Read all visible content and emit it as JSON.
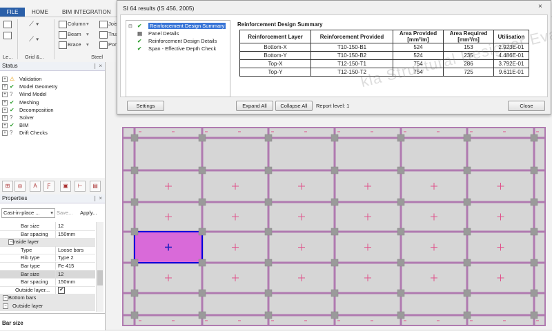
{
  "ribbon": {
    "file_tab": "FILE",
    "tabs": [
      "HOME",
      "BIM INTEGRATION"
    ],
    "tools": {
      "column": "Column",
      "joist": "Joist",
      "beam": "Beam",
      "truss": "Truss",
      "brace": "Brace",
      "port": "Port"
    },
    "groups": {
      "levels": "Le...",
      "grid": "Grid &...",
      "steel": "Steel"
    }
  },
  "status": {
    "title": "Status",
    "pin": "❘ ×",
    "items": [
      {
        "label": "Validation",
        "state": "warn"
      },
      {
        "label": "Model Geometry",
        "state": "ok"
      },
      {
        "label": "Wind Model",
        "state": "q"
      },
      {
        "label": "Meshing",
        "state": "ok"
      },
      {
        "label": "Decomposition",
        "state": "ok"
      },
      {
        "label": "Solver",
        "state": "q"
      },
      {
        "label": "BIM",
        "state": "ok"
      },
      {
        "label": "Drift Checks",
        "state": "q"
      }
    ]
  },
  "properties": {
    "title": "Properties",
    "type_select": "Cast-in-place ...",
    "save": "Save...",
    "apply": "Apply...",
    "rows": [
      {
        "name": "Bar size",
        "value": "12",
        "kind": "prop"
      },
      {
        "name": "Bar spacing",
        "value": "150mm",
        "kind": "prop"
      },
      {
        "name": "Inside layer",
        "value": "",
        "kind": "sec"
      },
      {
        "name": "Type",
        "value": "Loose bars",
        "kind": "prop"
      },
      {
        "name": "Rib type",
        "value": "Type 2",
        "kind": "prop"
      },
      {
        "name": "Bar type",
        "value": "Fe 415",
        "kind": "prop"
      },
      {
        "name": "Bar size",
        "value": "12",
        "kind": "prop"
      },
      {
        "name": "Bar spacing",
        "value": "150mm",
        "kind": "prop"
      },
      {
        "name": "Outside layer...",
        "value": "",
        "kind": "check"
      },
      {
        "name": "Bottom bars",
        "value": "",
        "kind": "sec"
      },
      {
        "name": "Outside layer",
        "value": "",
        "kind": "sec"
      }
    ],
    "footer_label": "Bar size"
  },
  "dialog": {
    "title": "SI 64 results (IS 456, 2005)",
    "close_icon": "×",
    "tree": [
      "Reinforcement Design Summary",
      "Panel Details",
      "Reinforcement Design Details",
      "Span - Effective Depth Check"
    ],
    "summary_title": "Reinforcement Design Summary",
    "table": {
      "headers": [
        "Reinforcement Layer",
        "Reinforcement Provided",
        "Area Provided [mm²/m]",
        "Area Required [mm²/m]",
        "Utilisation"
      ],
      "rows": [
        [
          "Bottom-X",
          "T10-150-B1",
          "524",
          "153",
          "2.923E-01"
        ],
        [
          "Bottom-Y",
          "T10-150-B2",
          "524",
          "235",
          "4.486E-01"
        ],
        [
          "Top-X",
          "T12-150-T1",
          "754",
          "286",
          "3.792E-01"
        ],
        [
          "Top-Y",
          "T12-150-T2",
          "754",
          "725",
          "9.611E-01"
        ]
      ]
    },
    "buttons": {
      "settings": "Settings",
      "expand_all": "Expand All",
      "collapse_all": "Collapse All",
      "close": "Close"
    },
    "report_level": "Report level: 1",
    "watermark": "kla Structural Designer Evaluation"
  },
  "colors": {
    "selected_panel": "#d96ad9",
    "grid_line": "#b07ab0",
    "column": "#9a9a9a",
    "marker": "#e0508a",
    "accent": "#2a5fa8"
  }
}
